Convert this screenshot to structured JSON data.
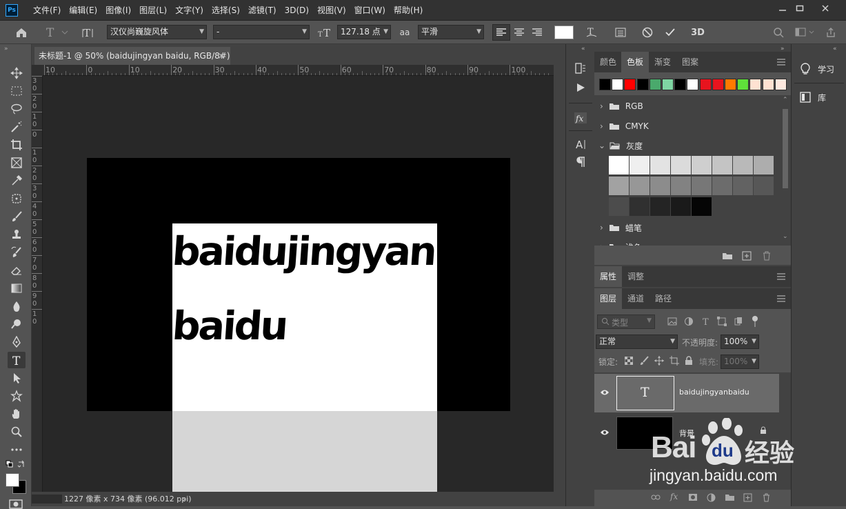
{
  "menubar": {
    "logo": "Ps",
    "items": [
      "文件(F)",
      "编辑(E)",
      "图像(I)",
      "图层(L)",
      "文字(Y)",
      "选择(S)",
      "滤镜(T)",
      "3D(D)",
      "视图(V)",
      "窗口(W)",
      "帮助(H)"
    ]
  },
  "options": {
    "font_family": "汉仪尚巍旋风体",
    "font_style": "-",
    "font_size": "127.18 点",
    "antialias_icon_label": "aa",
    "antialias": "平滑",
    "label_3d": "3D",
    "text_color": "#ffffff"
  },
  "document": {
    "tab_title": "未标题-1 @ 50% (baidujingyan baidu, RGB/8#) *",
    "close_glyph": "×",
    "canvas_line1": "baidujingyan",
    "canvas_line2": "baidu",
    "status": "1227 像素 x 734 像素 (96.012 ppi)",
    "hruler_labels": [
      "10",
      "0",
      "10",
      "20",
      "30",
      "40",
      "50",
      "60",
      "70",
      "80",
      "90",
      "100"
    ],
    "vruler_labels": [
      "3\n0",
      "2\n0",
      "1\n0",
      "0",
      "1\n0",
      "2\n0",
      "3\n0",
      "4\n0",
      "5\n0",
      "6\n0",
      "7\n0",
      "8\n0",
      "9\n0",
      "1\n0"
    ]
  },
  "swatches_panel": {
    "tabs": [
      "颜色",
      "色板",
      "渐变",
      "图案"
    ],
    "active_tab": "色板",
    "recent_colors": [
      "#000000",
      "#ffffff",
      "#ff0000",
      "#000000",
      "#4aa96c",
      "#7fd6a3",
      "#000000",
      "#ffffff",
      "#e8141e",
      "#e8141e",
      "#ff7a00",
      "#5fe03a",
      "#ffe2d2",
      "#ffe2d2",
      "#ffeae0"
    ],
    "groups": [
      "RGB",
      "CMYK",
      "灰度",
      "蜡笔",
      "浅色"
    ],
    "gray_swatches": [
      "#ffffff",
      "#efefef",
      "#e3e3e3",
      "#dbdbdb",
      "#cfcfcf",
      "#c4c4c4",
      "#b9b9b9",
      "#adadad",
      "#a2a2a2",
      "#979797",
      "#8c8c8c",
      "#828282",
      "#777777",
      "#6c6c6c",
      "#626262",
      "#575757",
      "#4c4c4c",
      "#303030",
      "#242424",
      "#1a1a1a",
      "#050505"
    ]
  },
  "properties_panel": {
    "tabs": [
      "属性",
      "调整"
    ]
  },
  "layers_panel": {
    "tabs": [
      "图层",
      "通道",
      "路径"
    ],
    "filter_placeholder": "类型",
    "blend_mode": "正常",
    "opacity_label": "不透明度:",
    "opacity_value": "100%",
    "lock_label": "锁定:",
    "fill_label": "填充:",
    "fill_value": "100%",
    "layers": [
      {
        "name": "baidujingyanbaidu",
        "type": "text",
        "thumb_glyph": "T"
      },
      {
        "name": "背景",
        "type": "background"
      }
    ]
  },
  "right_dock": {
    "items": [
      "学习",
      "库"
    ]
  },
  "watermark": {
    "brand_left": "Bai",
    "brand_mid": "du",
    "brand_cn": "经验",
    "url": "jingyan.baidu.com"
  }
}
